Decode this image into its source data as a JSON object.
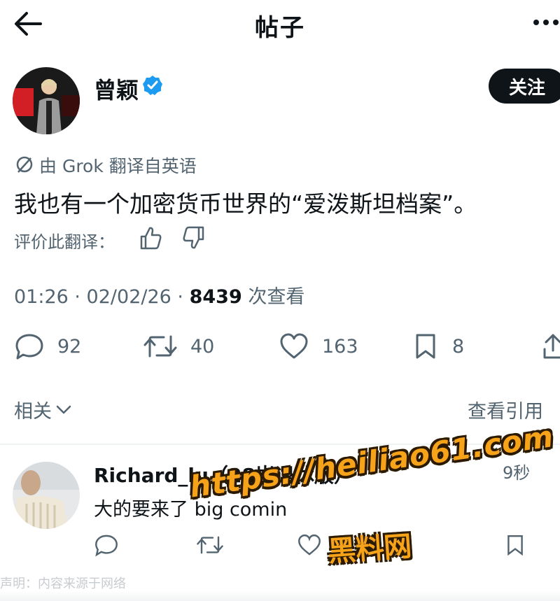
{
  "header": {
    "title": "帖子",
    "back_icon": "arrow-left-icon",
    "more_icon": "more-horizontal-icon"
  },
  "author": {
    "name": "曾颖",
    "verified": true,
    "follow_label": "关注"
  },
  "post": {
    "translation_note": "由 Grok 翻译自英语",
    "text": "我也有一个加密货币世界的“爱泼斯坦档案”。",
    "rate_label": "评价此翻译："
  },
  "meta": {
    "time": "01:26 · 02/02/26 · ",
    "views": "8439",
    "views_label": " 次查看"
  },
  "actions": {
    "replies": "92",
    "retweets": "40",
    "likes": "163",
    "bookmarks": "8"
  },
  "related": {
    "label": "相关",
    "view_quotes": "查看引用"
  },
  "reply": {
    "author": "Richard_lu（28岁退休版）",
    "time": "9秒",
    "text": "大的要来了 big comin"
  },
  "watermark": {
    "url": "https://heiliao61.com",
    "name": "黑料网",
    "disclaimer": "声明：内容来源于网络"
  },
  "colors": {
    "accent": "#1d9bf0",
    "text": "#0f1419",
    "secondary": "#536471",
    "watermark": "#f7a31a"
  }
}
